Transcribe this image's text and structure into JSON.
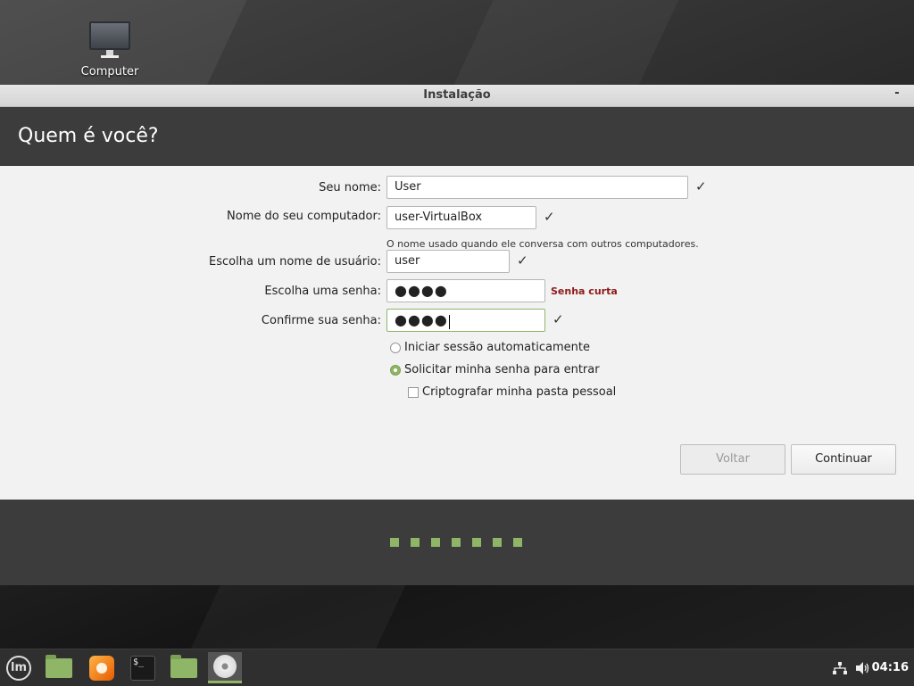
{
  "desktop": {
    "icon_label": "Computer"
  },
  "window": {
    "title": "Instalação",
    "minimize_glyph": "-",
    "heading": "Quem é você?"
  },
  "form": {
    "name": {
      "label": "Seu nome:",
      "value": "User"
    },
    "computer": {
      "label": "Nome do seu computador:",
      "value": "user-VirtualBox",
      "hint": "O nome usado quando ele conversa com outros computadores."
    },
    "username": {
      "label": "Escolha um nome de usuário:",
      "value": "user"
    },
    "password": {
      "label": "Escolha uma senha:",
      "value": "●●●●",
      "warning": "Senha curta"
    },
    "confirm": {
      "label": "Confirme sua senha:",
      "value": "●●●●"
    },
    "check_glyph": "✓",
    "options": {
      "auto_login": {
        "label": "Iniciar sessão automaticamente",
        "checked": false
      },
      "require_password": {
        "label": "Solicitar minha senha para entrar",
        "checked": true
      },
      "encrypt_home": {
        "label": "Criptografar minha pasta pessoal",
        "checked": false
      }
    }
  },
  "buttons": {
    "back": "Voltar",
    "continue": "Continuar"
  },
  "progress": {
    "total_steps": 7,
    "color": "#8fb566"
  },
  "taskbar": {
    "menu_logo": "lm",
    "terminal_prompt": "$_",
    "clock": "04:16",
    "tray_icons": [
      "network-icon",
      "volume-icon"
    ]
  },
  "colors": {
    "accent": "#8fb566",
    "warning": "#8b1a1a",
    "header_bg": "#3c3c3c"
  }
}
